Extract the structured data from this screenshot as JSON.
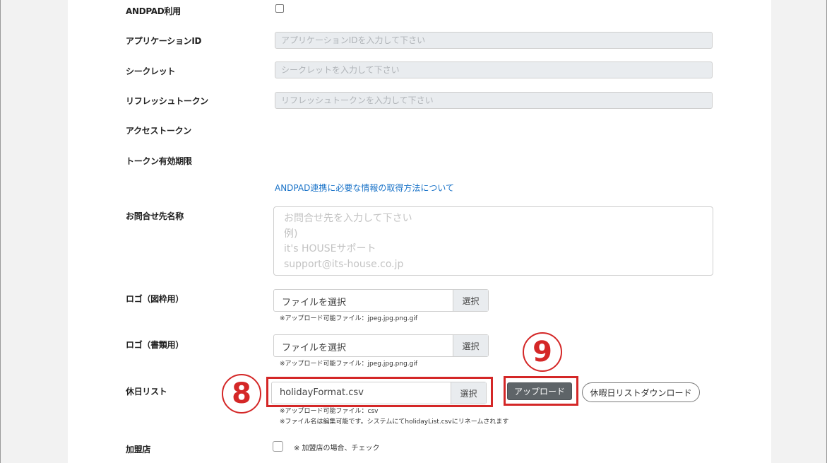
{
  "fields": {
    "andpad_use": {
      "label": "ANDPAD利用"
    },
    "app_id": {
      "label": "アプリケーションID",
      "placeholder": "アプリケーションIDを入力して下さい"
    },
    "secret": {
      "label": "シークレット",
      "placeholder": "シークレットを入力して下さい"
    },
    "refresh_token": {
      "label": "リフレッシュトークン",
      "placeholder": "リフレッシュトークンを入力して下さい"
    },
    "access_token": {
      "label": "アクセストークン"
    },
    "token_expiry": {
      "label": "トークン有効期限"
    },
    "andpad_help_link": "ANDPAD連携に必要な情報の取得方法について",
    "contact": {
      "label": "お問合せ先名称",
      "placeholder_lines": [
        "お問合せ先を入力して下さい",
        "例)",
        "it's HOUSEサポート",
        "support@its-house.co.jp"
      ]
    },
    "logo_frame": {
      "label": "ロゴ（図枠用）",
      "file_text": "ファイルを選択",
      "button": "選択",
      "note": "※アップロード可能ファイル：jpeg.jpg.png.gif"
    },
    "logo_doc": {
      "label": "ロゴ（書類用）",
      "file_text": "ファイルを選択",
      "button": "選択",
      "note": "※アップロード可能ファイル：jpeg.jpg.png.gif"
    },
    "holiday_list": {
      "label": "休日リスト",
      "file_text": "holidayFormat.csv",
      "button": "選択",
      "note1": "※アップロード可能ファイル：csv",
      "note2": "※ファイル名は編集可能です。システムにてholidayList.csvにリネームされます",
      "upload_button": "アップロード",
      "download_button": "休暇日リストダウンロード"
    },
    "franchise": {
      "label": "加盟店",
      "note": "※ 加盟店の場合、チェック"
    }
  },
  "annotations": {
    "step8": "8",
    "step9": "9"
  },
  "colors": {
    "annotation_red": "#d42727",
    "link_blue": "#1a73c8",
    "upload_button": "#5e6468"
  }
}
